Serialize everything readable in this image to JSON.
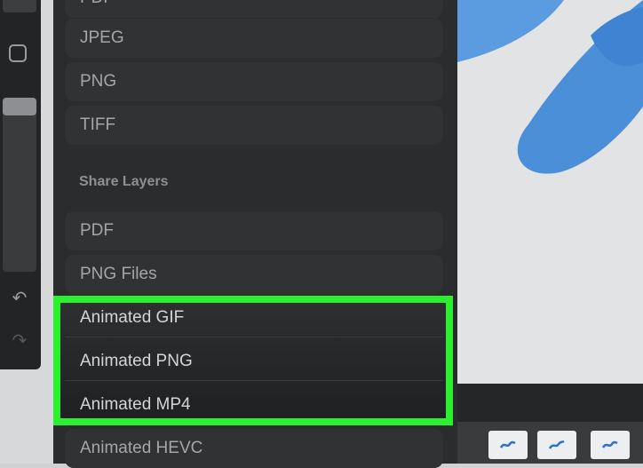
{
  "export_formats": [
    {
      "label": "PDF"
    },
    {
      "label": "JPEG"
    },
    {
      "label": "PNG"
    },
    {
      "label": "TIFF"
    }
  ],
  "share_layers": {
    "header": "Share Layers",
    "items": [
      {
        "label": "PDF"
      },
      {
        "label": "PNG Files"
      },
      {
        "label": "Animated GIF"
      },
      {
        "label": "Animated PNG"
      },
      {
        "label": "Animated MP4"
      },
      {
        "label": "Animated HEVC"
      }
    ]
  },
  "colors": {
    "highlight": "#2bf030",
    "brush_blue": "#4a8fd8"
  },
  "icons": [
    "square-icon",
    "undo-icon",
    "redo-icon",
    "brush-thumbnail-icon"
  ]
}
